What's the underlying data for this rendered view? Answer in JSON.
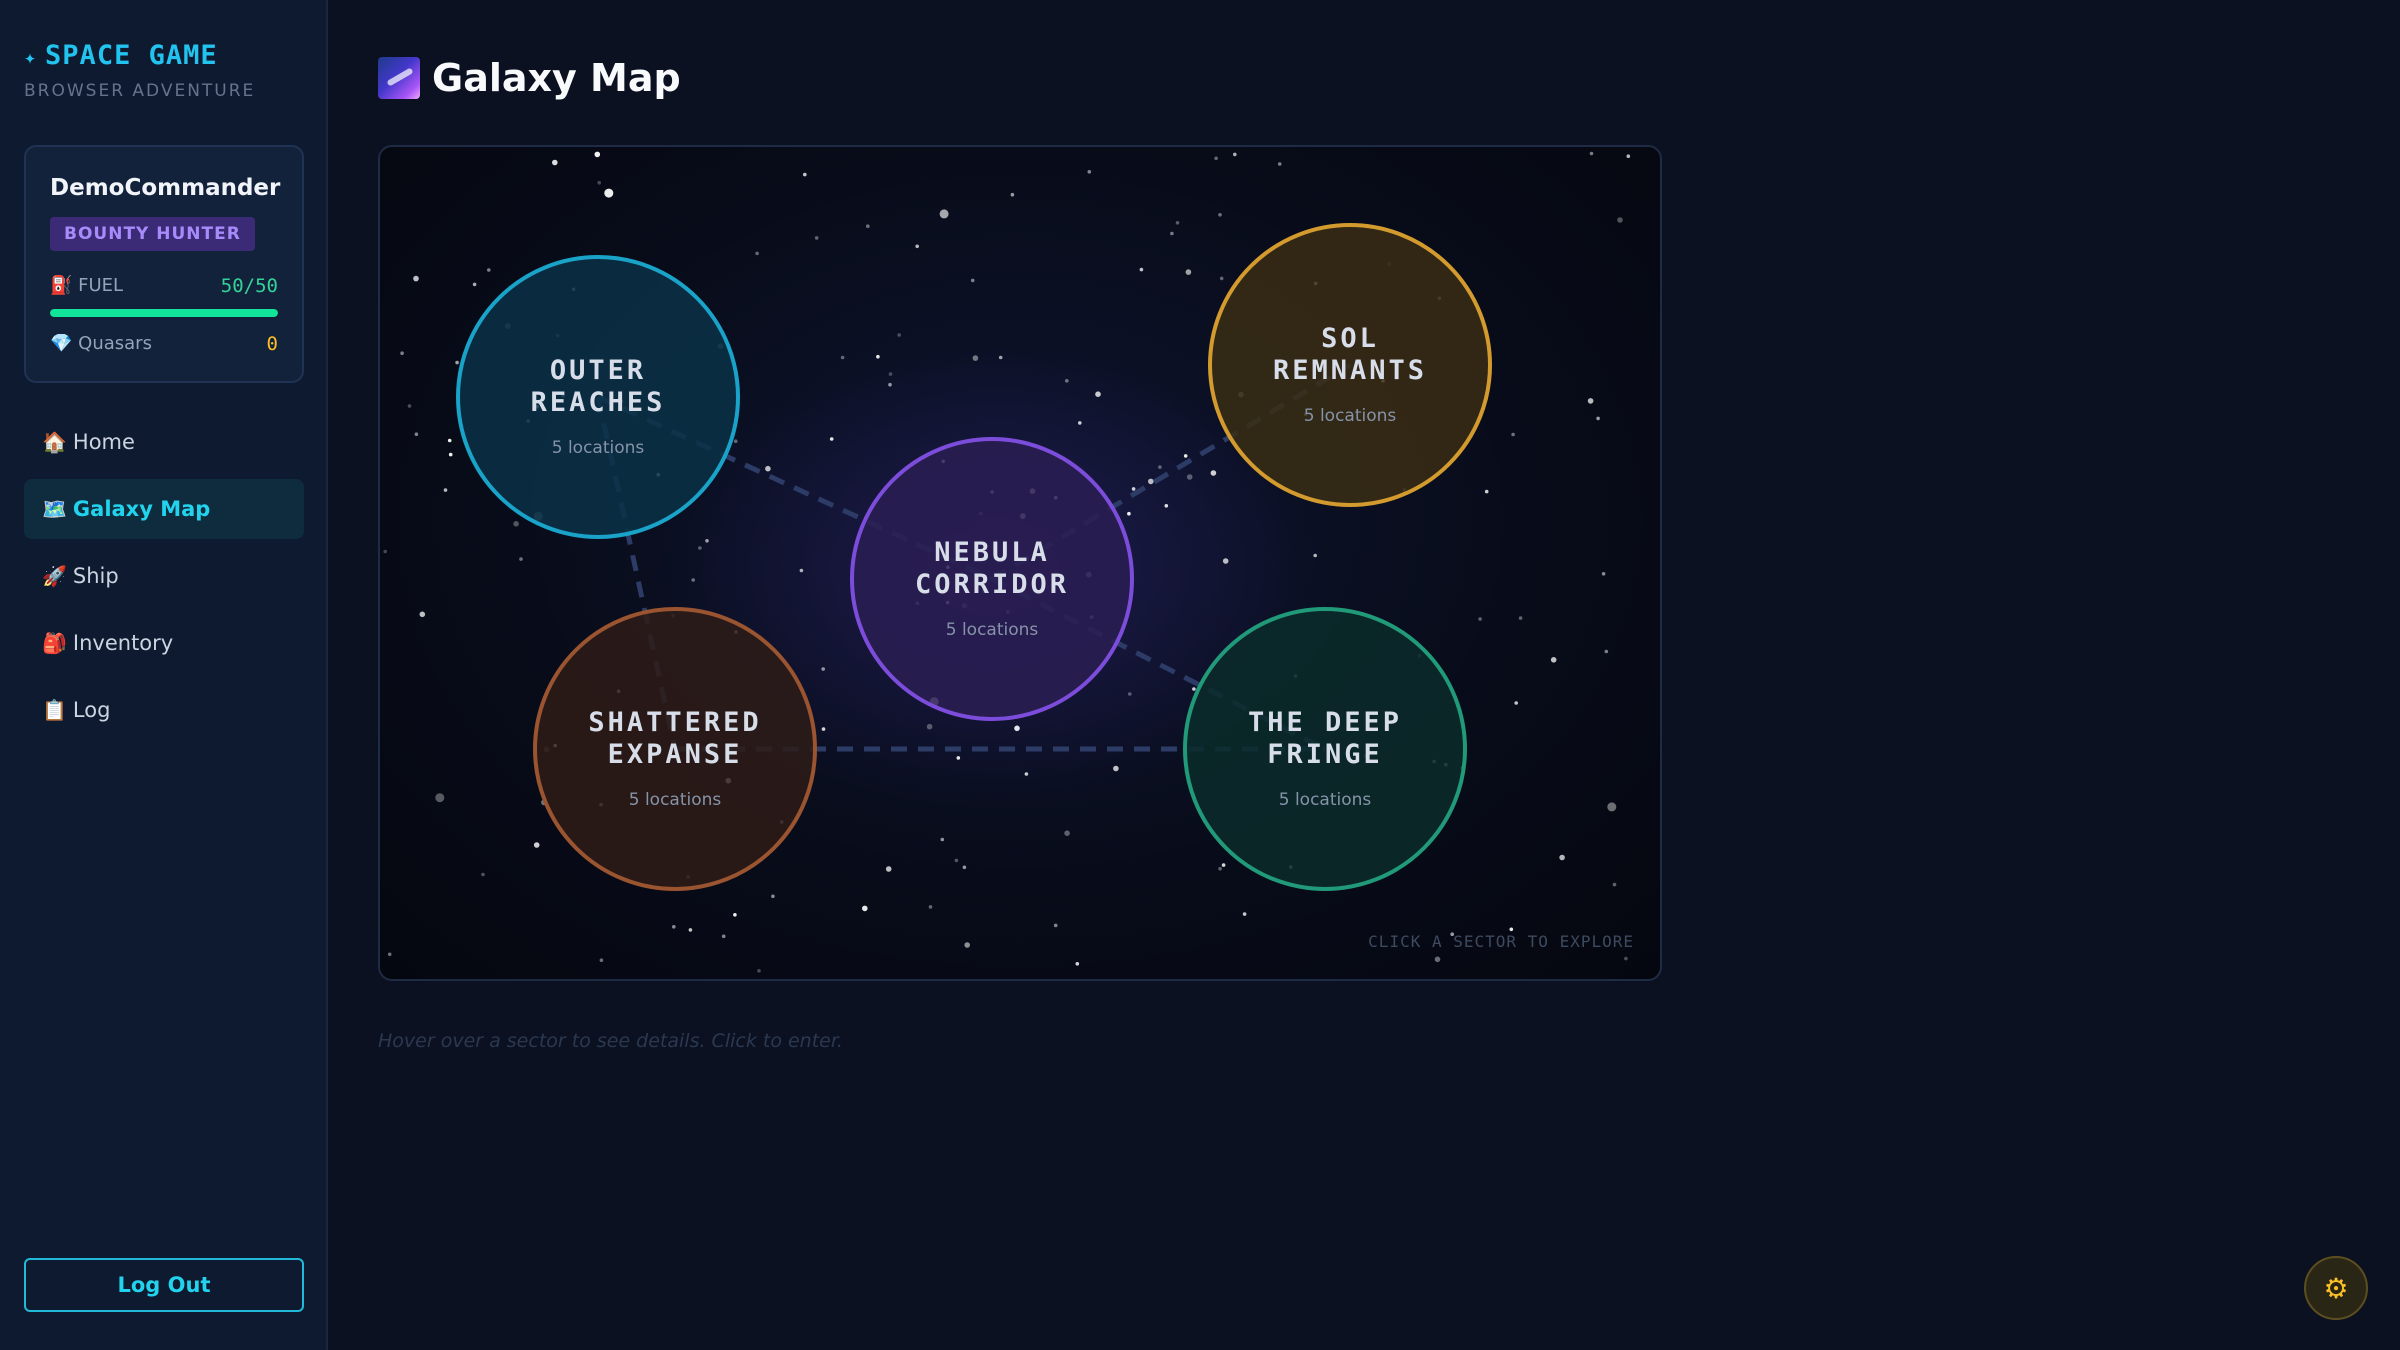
{
  "brand": {
    "title": "SPACE GAME",
    "subtitle": "BROWSER ADVENTURE",
    "star_icon": "✦"
  },
  "player": {
    "name": "DemoCommander",
    "class_badge": "BOUNTY HUNTER",
    "fuel_label": "FUEL",
    "fuel_icon": "⛽",
    "fuel_value": "50/50",
    "fuel_fraction": 1.0,
    "quasars_label": "Quasars",
    "quasars_icon": "💎",
    "quasars_value": "0"
  },
  "nav": {
    "items": [
      {
        "icon": "🏠",
        "label": "Home"
      },
      {
        "icon": "🗺️",
        "label": "Galaxy Map"
      },
      {
        "icon": "🚀",
        "label": "Ship"
      },
      {
        "icon": "🎒",
        "label": "Inventory"
      },
      {
        "icon": "📋",
        "label": "Log"
      }
    ],
    "active_index": 1
  },
  "logout_label": "Log Out",
  "page": {
    "title": "Galaxy Map",
    "title_icon": "milky-way-icon"
  },
  "map": {
    "hint": "CLICK A SECTOR TO EXPLORE",
    "caption": "Hover over a sector to see details. Click to enter.",
    "sectors": [
      {
        "id": "outer-reaches",
        "name_lines": [
          "OUTER",
          "REACHES"
        ],
        "count_label": "5 locations",
        "color": "#1aa3c8",
        "fill": "#0b3147"
      },
      {
        "id": "sol-remnants",
        "name_lines": [
          "SOL",
          "REMNANTS"
        ],
        "count_label": "5 locations",
        "color": "#d39a2e",
        "fill": "#3a2d14"
      },
      {
        "id": "nebula-corridor",
        "name_lines": [
          "NEBULA",
          "CORRIDOR"
        ],
        "count_label": "5 locations",
        "color": "#7c4ddb",
        "fill": "#2a1d52"
      },
      {
        "id": "shattered-expanse",
        "name_lines": [
          "SHATTERED",
          "EXPANSE"
        ],
        "count_label": "5 locations",
        "color": "#9a5430",
        "fill": "#2e1c17"
      },
      {
        "id": "the-deep-fringe",
        "name_lines": [
          "THE DEEP",
          "FRINGE"
        ],
        "count_label": "5 locations",
        "color": "#209a78",
        "fill": "#0b2b2a"
      }
    ]
  },
  "settings_icon": "gear-icon"
}
